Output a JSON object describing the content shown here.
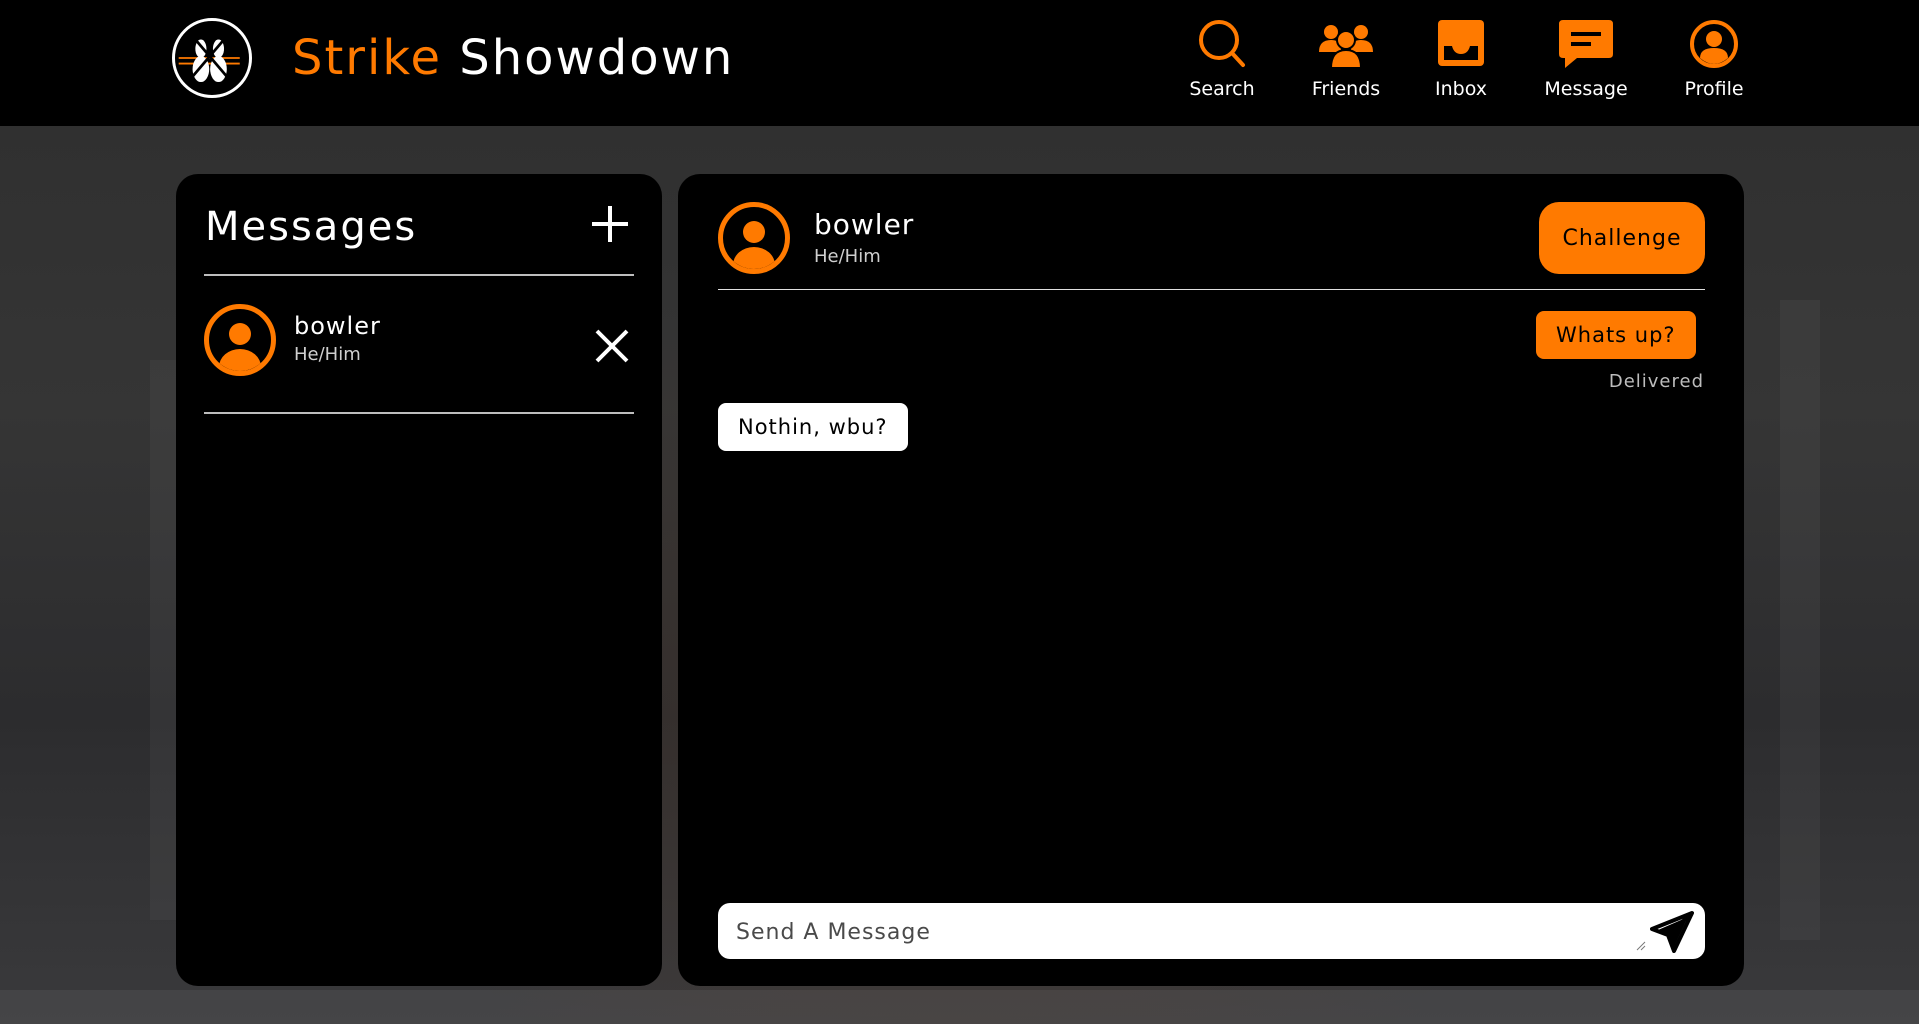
{
  "app": {
    "brand_part1": "Strike",
    "brand_part2": "Showdown",
    "accent_color": "#ff7a00"
  },
  "nav": [
    {
      "label": "Search",
      "icon": "search-icon"
    },
    {
      "label": "Friends",
      "icon": "friends-icon"
    },
    {
      "label": "Inbox",
      "icon": "inbox-icon"
    },
    {
      "label": "Message",
      "icon": "message-icon"
    },
    {
      "label": "Profile",
      "icon": "profile-icon"
    }
  ],
  "sidebar": {
    "title": "Messages",
    "contacts": [
      {
        "name": "bowler",
        "pronouns": "He/Him"
      }
    ]
  },
  "chat": {
    "name": "bowler",
    "pronouns": "He/Him",
    "challenge_label": "Challenge",
    "messages": [
      {
        "text": "Whats up?",
        "direction": "outgoing",
        "status": "Delivered"
      },
      {
        "text": "Nothin, wbu?",
        "direction": "incoming"
      }
    ],
    "input_placeholder": "Send A Message"
  }
}
